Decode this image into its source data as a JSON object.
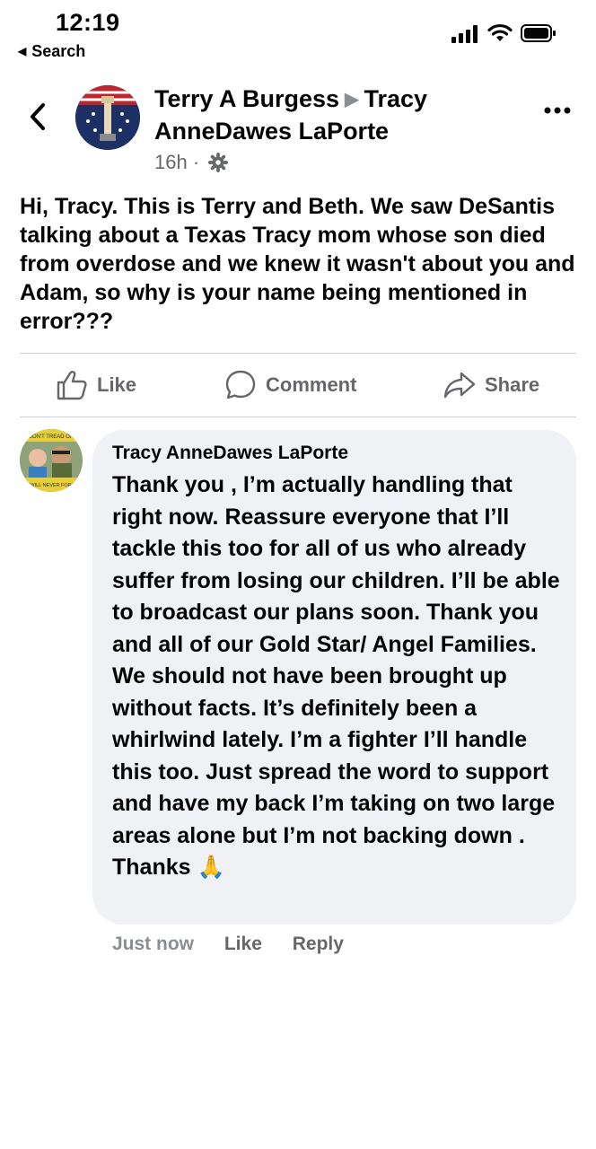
{
  "status_bar": {
    "time": "12:19",
    "back_app_label": "Search"
  },
  "post": {
    "author": "Terry A Burgess",
    "recipient": "Tracy AnneDawes LaPorte",
    "timestamp": "16h",
    "separator": "·",
    "text": "Hi, Tracy. This is Terry and Beth. We saw DeSantis talking about a Texas Tracy mom whose son died from overdose and we knew it wasn't about you and Adam, so why is your name being mentioned in error???"
  },
  "actions": {
    "like": "Like",
    "comment": "Comment",
    "share": "Share"
  },
  "comment": {
    "author": "Tracy AnneDawes LaPorte",
    "text": "Thank you , I’m actually handling that right now. Reassure everyone that I’ll tackle this too for all of us who already suffer from losing our children. I’ll be able to broadcast our plans soon. Thank you and all of our Gold Star/ Angel Families. We should not have been brought up without facts. It’s definitely been a whirlwind lately. I’m a fighter I’ll handle this too. Just spread the word to support and have my back I’m taking on two large areas alone but I’m not backing down . Thanks 🙏",
    "time": "Just now",
    "like": "Like",
    "reply": "Reply",
    "avatar_badge_top": "DON'T TREAD ON",
    "avatar_badge_bottom": "WE WILL NEVER FORGET"
  },
  "icons": {
    "signal": "cellular-signal-icon",
    "wifi": "wifi-icon",
    "battery": "battery-icon",
    "back": "chevron-left-icon",
    "more": "more-dots-icon",
    "privacy": "gear-icon",
    "like": "thumbs-up-icon",
    "comment": "speech-bubble-icon",
    "share": "share-arrow-icon"
  },
  "colors": {
    "text": "#050505",
    "secondary": "#65676b",
    "bubble": "#eff1f4",
    "divider": "#ced0d4"
  }
}
